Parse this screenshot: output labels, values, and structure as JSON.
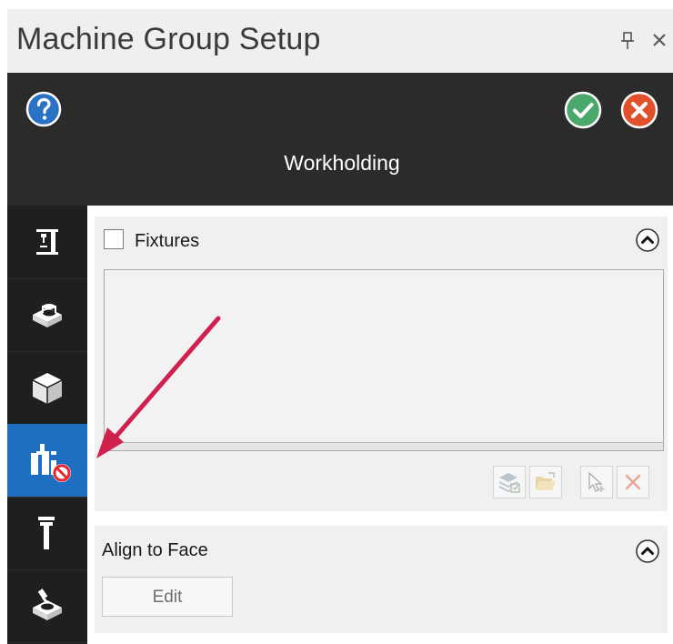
{
  "window": {
    "title": "Machine Group Setup",
    "pin_icon": "pin-icon",
    "close_icon": "close-icon"
  },
  "header": {
    "title": "Workholding",
    "help_icon": "question-circle-icon",
    "ok_icon": "check-circle-icon",
    "cancel_icon": "x-circle-icon",
    "colors": {
      "help": "#2a72c4",
      "ok": "#4aa86a",
      "cancel": "#e0502b",
      "background": "#2b2b2b"
    }
  },
  "sidebar": {
    "items": [
      {
        "icon": "machine-icon",
        "active": false
      },
      {
        "icon": "stock-icon",
        "active": false
      },
      {
        "icon": "part-cube-icon",
        "active": false
      },
      {
        "icon": "workholding-disabled-icon",
        "active": true
      },
      {
        "icon": "tool-icon",
        "active": false
      },
      {
        "icon": "stock-model-icon",
        "active": false
      }
    ],
    "active_color": "#1e6fc2"
  },
  "fixtures": {
    "label": "Fixtures",
    "checked": false,
    "toolbar": [
      {
        "icon": "add-layers-icon"
      },
      {
        "icon": "open-folder-icon"
      },
      {
        "icon": "select-cursor-icon"
      },
      {
        "icon": "delete-x-icon"
      }
    ]
  },
  "align_to_face": {
    "label": "Align to Face",
    "edit_label": "Edit"
  },
  "annotation": {
    "arrow_color": "#d0204e"
  }
}
